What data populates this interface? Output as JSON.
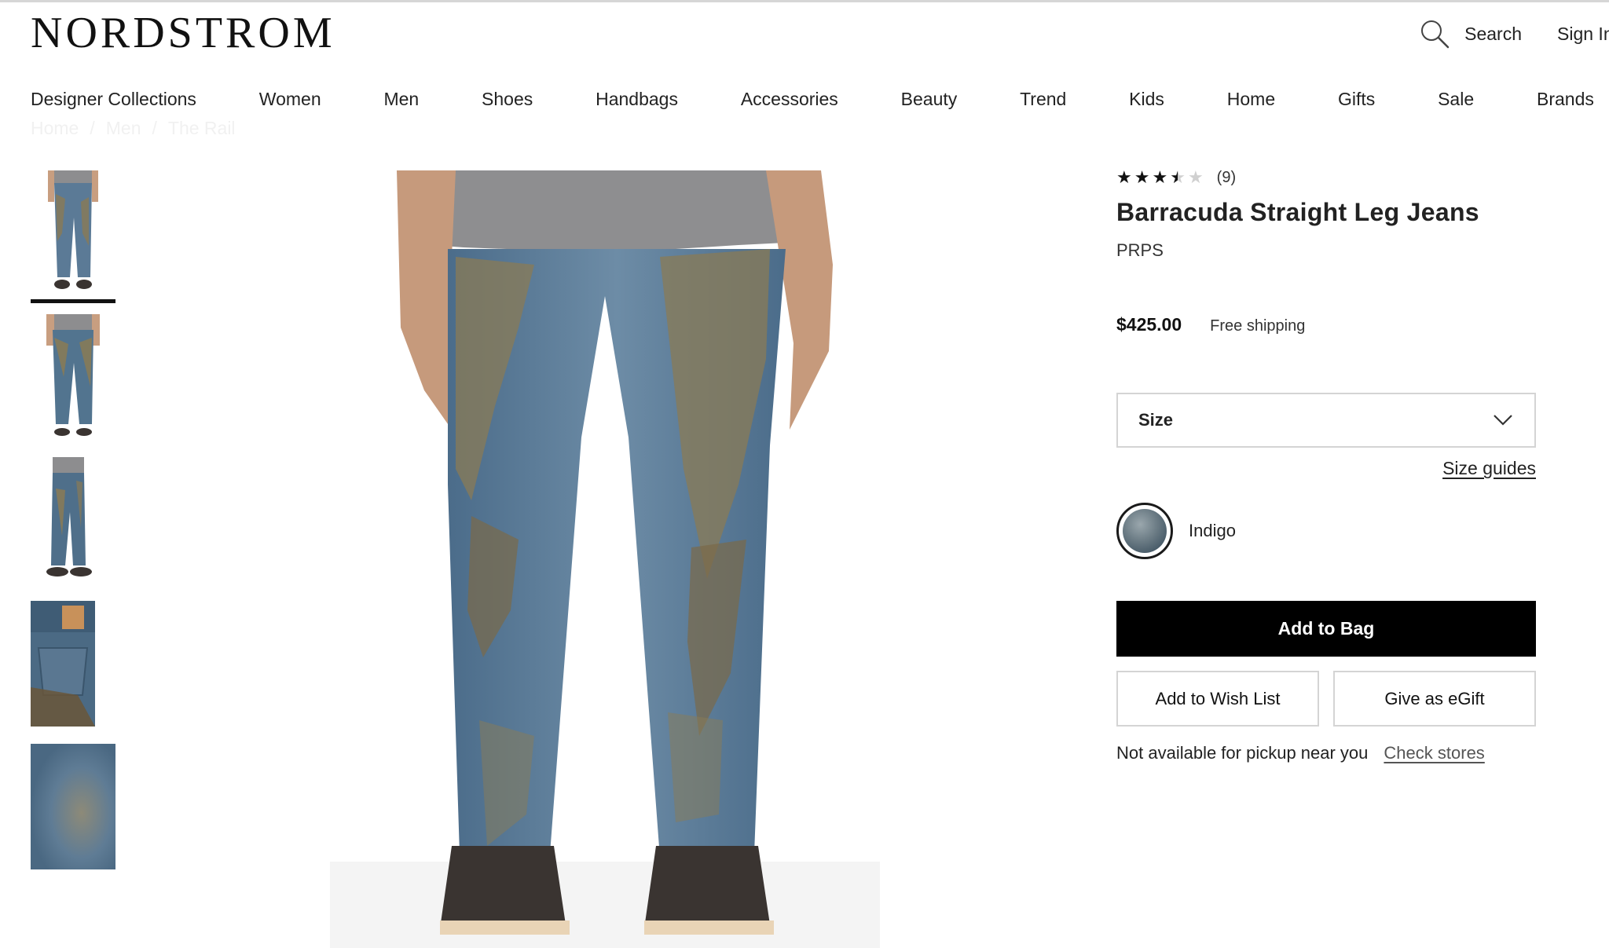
{
  "header": {
    "logo": "NORDSTROM",
    "search_label": "Search",
    "signin_label": "Sign In"
  },
  "nav": {
    "items": [
      "Designer Collections",
      "Women",
      "Men",
      "Shoes",
      "Handbags",
      "Accessories",
      "Beauty",
      "Trend",
      "Kids",
      "Home",
      "Gifts",
      "Sale",
      "Brands"
    ]
  },
  "breadcrumb": {
    "items": [
      "Home",
      "/",
      "Men",
      "/",
      "The Rail"
    ]
  },
  "product": {
    "rating_stars": 3.5,
    "review_count": "(9)",
    "title": "Barracuda Straight Leg Jeans",
    "brand": "PRPS",
    "price": "$425.00",
    "shipping": "Free shipping",
    "size_label": "Size",
    "size_guides_label": "Size guides",
    "color_name": "Indigo",
    "add_to_bag_label": "Add to Bag",
    "wish_list_label": "Add to Wish List",
    "egift_label": "Give as eGift",
    "pickup_text": "Not available for pickup near you",
    "check_stores_label": "Check stores"
  },
  "colors": {
    "denim": "#5b7a96",
    "mud": "#8a7b55",
    "accent_black": "#000000"
  }
}
